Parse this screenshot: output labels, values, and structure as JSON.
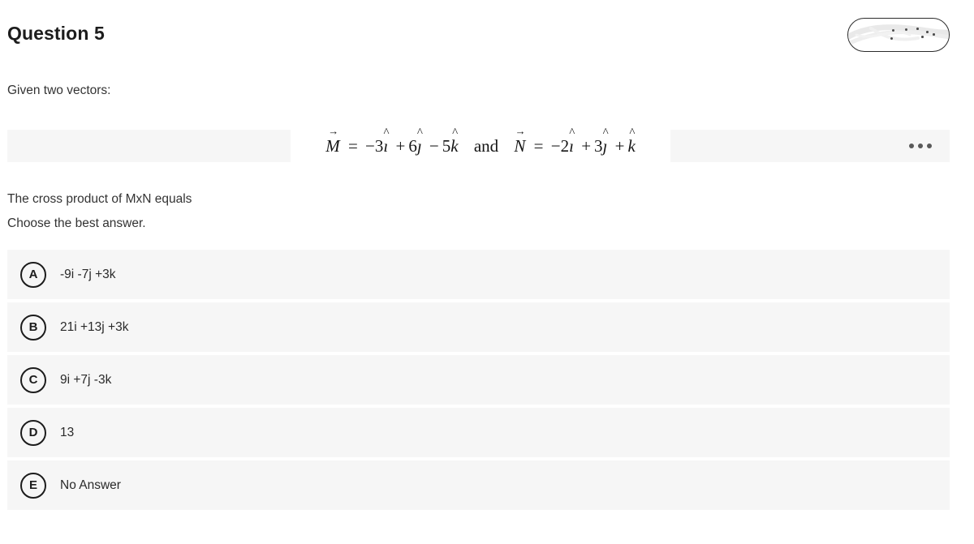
{
  "header": {
    "title": "Question 5",
    "badge": {
      "name": "redacted-watermark-badge",
      "label": ""
    }
  },
  "content": {
    "intro": "Given two vectors:",
    "formula": {
      "vector_m": {
        "name": "M",
        "equals": "=",
        "terms": "−3î + 6ĵ − 5k̂"
      },
      "conjunction": "and",
      "vector_n": {
        "name": "N",
        "equals": "=",
        "terms": "−2î + 3ĵ + k̂"
      },
      "parts": {
        "m_label": "M",
        "m_eq": "=",
        "m_c1_sign": "−",
        "m_c1_num": "3",
        "m_c1_unit": "ı",
        "m_c2_sign": "+",
        "m_c2_num": "6",
        "m_c2_unit": "ȷ",
        "m_c3_sign": "−",
        "m_c3_num": "5",
        "m_c3_unit": "k",
        "and": "and",
        "n_label": "N",
        "n_eq": "=",
        "n_c1_sign": "−",
        "n_c1_num": "2",
        "n_c1_unit": "ı",
        "n_c2_sign": "+",
        "n_c2_num": "3",
        "n_c2_unit": "ȷ",
        "n_c3_sign": "+",
        "n_c3_num": "",
        "n_c3_unit": "k"
      }
    },
    "more_options_icon": "kebab-menu-icon",
    "question_line_1": "The cross product of MxN equals",
    "question_line_2": "Choose the best answer."
  },
  "options": [
    {
      "letter": "A",
      "text": "-9i -7j +3k"
    },
    {
      "letter": "B",
      "text": "21i +13j +3k"
    },
    {
      "letter": "C",
      "text": "9i +7j -3k"
    },
    {
      "letter": "D",
      "text": "13"
    },
    {
      "letter": "E",
      "text": "No Answer"
    }
  ],
  "colors": {
    "page_background": "#ffffff",
    "row_background": "#f6f6f6",
    "strip_background": "#f6f6f6",
    "text_primary": "#1c1c1c",
    "text_secondary": "#333333",
    "badge_border": "#1c1c1c",
    "kebab_dot": "#5a5a5a"
  }
}
